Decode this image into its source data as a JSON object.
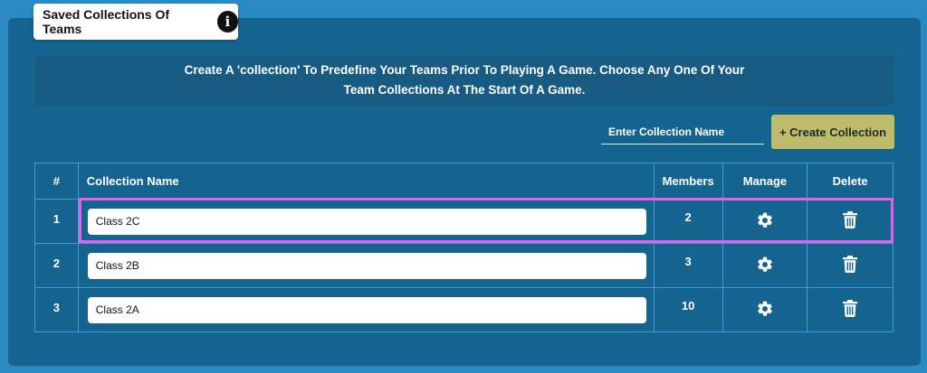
{
  "title": "Saved Collections Of Teams",
  "banner": {
    "line1": "Create A 'collection' To Predefine Your Teams Prior To Playing A Game. Choose Any One Of Your",
    "line2": "Team Collections At The Start Of A Game."
  },
  "create": {
    "placeholder": "Enter Collection Name",
    "button_label": "+ Create Collection"
  },
  "table": {
    "headers": {
      "num": "#",
      "name": "Collection Name",
      "members": "Members",
      "manage": "Manage",
      "delete": "Delete"
    },
    "rows": [
      {
        "num": "1",
        "name": "Class 2C",
        "members": "2"
      },
      {
        "num": "2",
        "name": "Class 2B",
        "members": "3"
      },
      {
        "num": "3",
        "name": "Class 2A",
        "members": "10"
      }
    ]
  },
  "colors": {
    "page_bg": "#2a89c2",
    "panel_bg": "#14648f",
    "button_bg": "#bebc6a",
    "highlight": "#ee5bef"
  }
}
